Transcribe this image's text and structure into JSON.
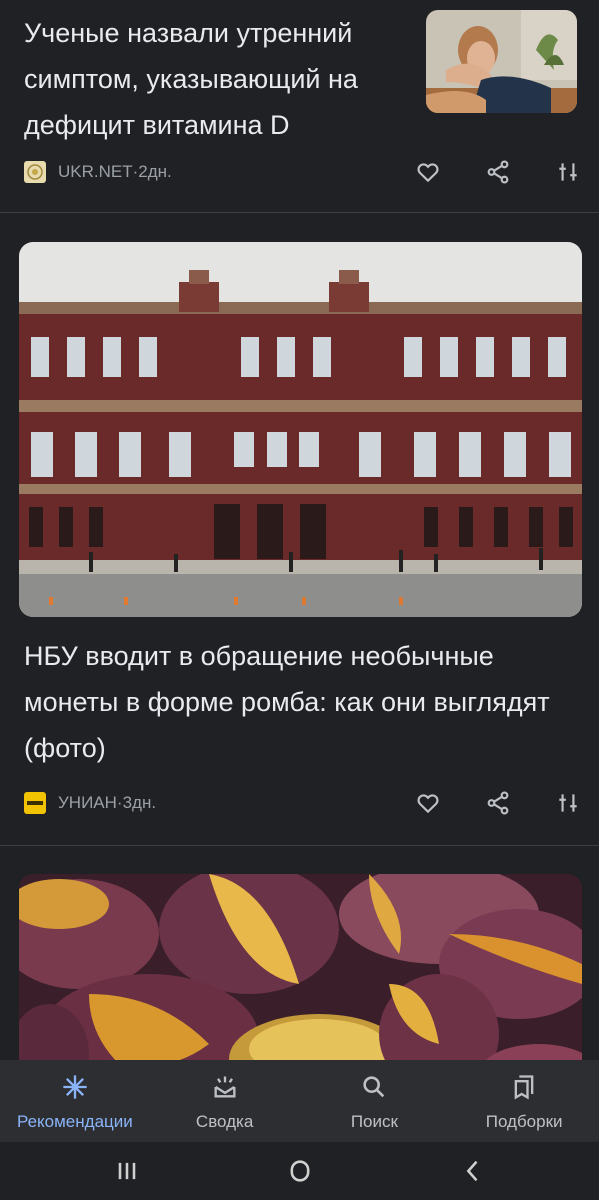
{
  "feed": [
    {
      "title": "Ученые назвали утренний симптом, указывающий на дефицит витамина D",
      "source": "UKR.NET",
      "age": "2дн.",
      "source_icon": "ukrnet-logo-icon"
    },
    {
      "title": "НБУ вводит в обращение необычные монеты в форме ромба: как они выглядят (фото)",
      "source": "УНИАН",
      "age": "3дн.",
      "source_icon": "unian-logo-icon"
    }
  ],
  "meta_separator": " · ",
  "actions": [
    "heart-icon",
    "share-icon",
    "tune-icon"
  ],
  "bottom_nav": {
    "items": [
      {
        "label": "Рекомендации",
        "icon": "sparkle-icon",
        "active": true
      },
      {
        "label": "Сводка",
        "icon": "updates-icon",
        "active": false
      },
      {
        "label": "Поиск",
        "icon": "search-icon",
        "active": false
      },
      {
        "label": "Подборки",
        "icon": "collections-icon",
        "active": false
      }
    ]
  },
  "system_nav": [
    "recents-icon",
    "home-icon",
    "back-icon"
  ],
  "colors": {
    "background": "#202124",
    "accent": "#8ab4f8",
    "nav_background": "#2d2e31",
    "text_secondary": "#9aa0a6"
  }
}
